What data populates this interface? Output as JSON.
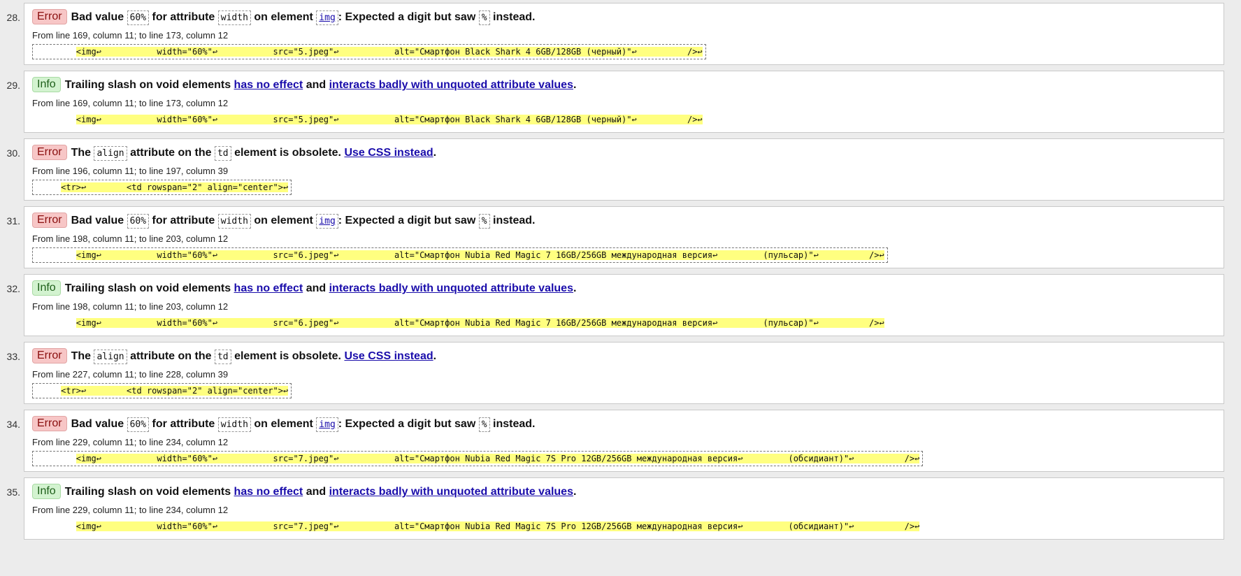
{
  "messages": [
    {
      "number": "28.",
      "type": "error",
      "badge": "Error",
      "kind": "badvalue",
      "text": [
        "Bad value",
        "60%",
        "for attribute",
        "width",
        "on element",
        "img",
        ": Expected a digit but saw",
        "%",
        "instead."
      ],
      "location": "From line 169, column 11; to line 173, column 12",
      "extract_lead": "        ",
      "extract_code": "<img↩           width=\"60%\"↩           src=\"5.jpeg\"↩           alt=\"Смартфон Black Shark 4 6GB/128GB (черный)\"↩          />↩"
    },
    {
      "number": "29.",
      "type": "info",
      "badge": "Info",
      "kind": "slash",
      "text": [
        "Trailing slash on void elements",
        "has no effect",
        "and",
        "interacts badly with unquoted attribute values",
        "."
      ],
      "location": "From line 169, column 11; to line 173, column 12",
      "extract_lead": "        ",
      "extract_code": "<img↩           width=\"60%\"↩           src=\"5.jpeg\"↩           alt=\"Смартфон Black Shark 4 6GB/128GB (черный)\"↩          />↩"
    },
    {
      "number": "30.",
      "type": "error",
      "badge": "Error",
      "kind": "align",
      "text": [
        "The",
        "align",
        "attribute on the",
        "td",
        "element is obsolete.",
        "Use CSS instead",
        "."
      ],
      "location": "From line 196, column 11; to line 197, column 39",
      "extract_lead": "     ",
      "extract_code": "<tr>↩        <td rowspan=\"2\" align=\"center\">↩"
    },
    {
      "number": "31.",
      "type": "error",
      "badge": "Error",
      "kind": "badvalue",
      "text": [
        "Bad value",
        "60%",
        "for attribute",
        "width",
        "on element",
        "img",
        ": Expected a digit but saw",
        "%",
        "instead."
      ],
      "location": "From line 198, column 11; to line 203, column 12",
      "extract_lead": "        ",
      "extract_code": "<img↩           width=\"60%\"↩           src=\"6.jpeg\"↩           alt=\"Смартфон Nubia Red Magic 7 16GB/256GB международная версия↩         (пульсар)\"↩          />↩"
    },
    {
      "number": "32.",
      "type": "info",
      "badge": "Info",
      "kind": "slash",
      "text": [
        "Trailing slash on void elements",
        "has no effect",
        "and",
        "interacts badly with unquoted attribute values",
        "."
      ],
      "location": "From line 198, column 11; to line 203, column 12",
      "extract_lead": "        ",
      "extract_code": "<img↩           width=\"60%\"↩           src=\"6.jpeg\"↩           alt=\"Смартфон Nubia Red Magic 7 16GB/256GB международная версия↩         (пульсар)\"↩          />↩"
    },
    {
      "number": "33.",
      "type": "error",
      "badge": "Error",
      "kind": "align",
      "text": [
        "The",
        "align",
        "attribute on the",
        "td",
        "element is obsolete.",
        "Use CSS instead",
        "."
      ],
      "location": "From line 227, column 11; to line 228, column 39",
      "extract_lead": "     ",
      "extract_code": "<tr>↩        <td rowspan=\"2\" align=\"center\">↩"
    },
    {
      "number": "34.",
      "type": "error",
      "badge": "Error",
      "kind": "badvalue",
      "text": [
        "Bad value",
        "60%",
        "for attribute",
        "width",
        "on element",
        "img",
        ": Expected a digit but saw",
        "%",
        "instead."
      ],
      "location": "From line 229, column 11; to line 234, column 12",
      "extract_lead": "        ",
      "extract_code": "<img↩           width=\"60%\"↩           src=\"7.jpeg\"↩           alt=\"Смартфон Nubia Red Magic 7S Pro 12GB/256GB международная версия↩         (обсидиант)\"↩          />↩"
    },
    {
      "number": "35.",
      "type": "info",
      "badge": "Info",
      "kind": "slash",
      "text": [
        "Trailing slash on void elements",
        "has no effect",
        "and",
        "interacts badly with unquoted attribute values",
        "."
      ],
      "location": "From line 229, column 11; to line 234, column 12",
      "extract_lead": "        ",
      "extract_code": "<img↩           width=\"60%\"↩           src=\"7.jpeg\"↩           alt=\"Смартфон Nubia Red Magic 7S Pro 12GB/256GB международная версия↩         (обсидиант)\"↩          />↩"
    }
  ],
  "colors": {
    "error_badge_bg": "#f7c6c6",
    "info_badge_bg": "#d3f3d0",
    "highlight": "#ffff80",
    "link": "#1a0dab"
  }
}
